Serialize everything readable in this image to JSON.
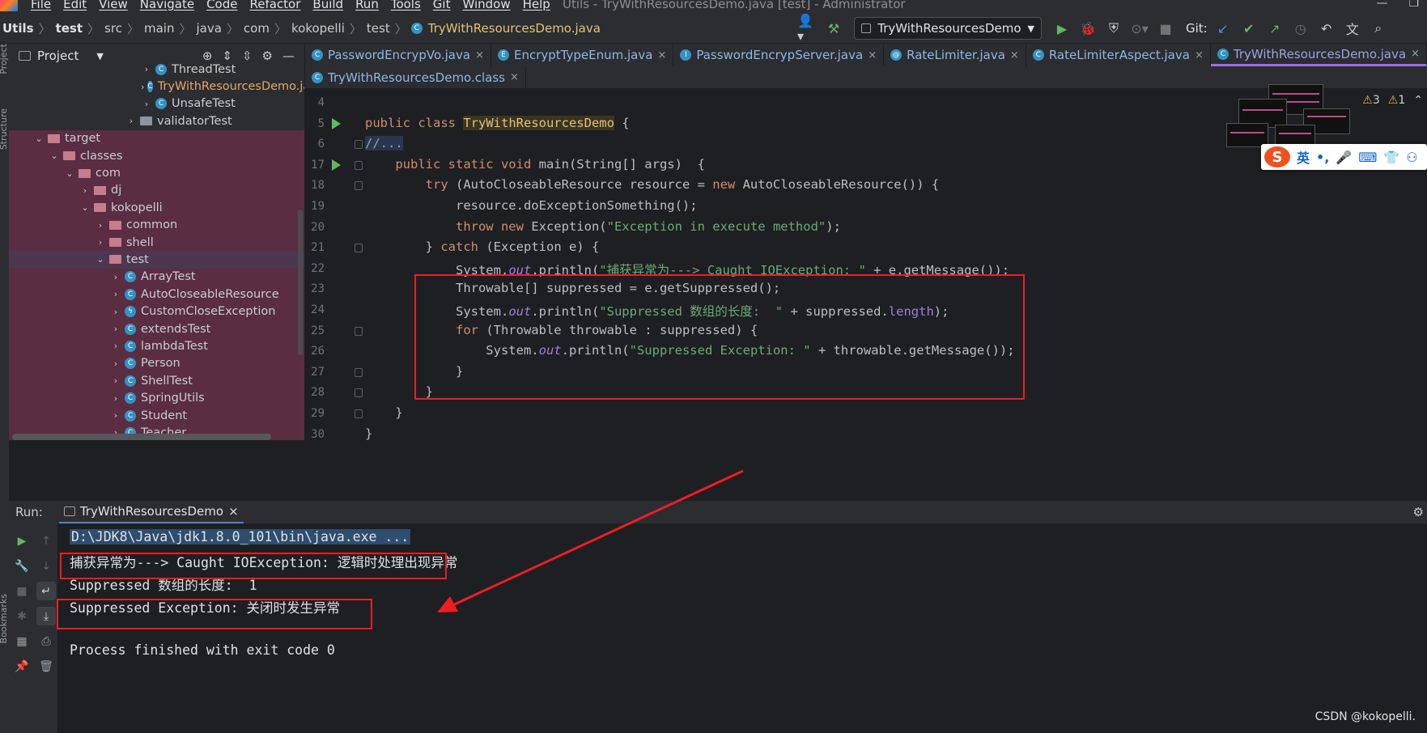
{
  "menu": {
    "items": [
      "File",
      "Edit",
      "View",
      "Navigate",
      "Code",
      "Refactor",
      "Build",
      "Run",
      "Tools",
      "Git",
      "Window",
      "Help"
    ],
    "window_title": "Utils - TryWithResourcesDemo.java [test] - Administrator"
  },
  "breadcrumb": [
    "Utils",
    "test",
    "src",
    "main",
    "java",
    "com",
    "kokopelli",
    "test",
    "TryWithResourcesDemo.java"
  ],
  "toolbar": {
    "run_config": "TryWithResourcesDemo",
    "git_label": "Git:"
  },
  "project": {
    "title": "Project",
    "tree": [
      {
        "label": "ThreadTest",
        "kind": "class",
        "depth": 9,
        "arrow": "›",
        "bg": ""
      },
      {
        "label": "TryWithResourcesDemo.java",
        "kind": "class",
        "depth": 9,
        "arrow": "›",
        "bg": "",
        "orange": true
      },
      {
        "label": "UnsafeTest",
        "kind": "class",
        "depth": 9,
        "arrow": "›",
        "bg": ""
      },
      {
        "label": "validatorTest",
        "kind": "dirgrey",
        "depth": 8,
        "arrow": "›",
        "bg": ""
      },
      {
        "label": "target",
        "kind": "dir",
        "depth": 2,
        "arrow": "⌄",
        "bg": "pink"
      },
      {
        "label": "classes",
        "kind": "dir",
        "depth": 3,
        "arrow": "⌄",
        "bg": "pink"
      },
      {
        "label": "com",
        "kind": "dir",
        "depth": 4,
        "arrow": "⌄",
        "bg": "pink"
      },
      {
        "label": "dj",
        "kind": "dir",
        "depth": 5,
        "arrow": "›",
        "bg": "pink"
      },
      {
        "label": "kokopelli",
        "kind": "dir",
        "depth": 5,
        "arrow": "⌄",
        "bg": "pink"
      },
      {
        "label": "common",
        "kind": "dir",
        "depth": 6,
        "arrow": "›",
        "bg": "pink"
      },
      {
        "label": "shell",
        "kind": "dir",
        "depth": 6,
        "arrow": "›",
        "bg": "pink"
      },
      {
        "label": "test",
        "kind": "dir",
        "depth": 6,
        "arrow": "⌄",
        "bg": "sel"
      },
      {
        "label": "ArrayTest",
        "kind": "class",
        "depth": 7,
        "arrow": "›",
        "bg": "pink"
      },
      {
        "label": "AutoCloseableResource",
        "kind": "class",
        "depth": 7,
        "arrow": "›",
        "bg": "pink"
      },
      {
        "label": "CustomCloseException",
        "kind": "lightning",
        "depth": 7,
        "arrow": "›",
        "bg": "pink"
      },
      {
        "label": "extendsTest",
        "kind": "class",
        "depth": 7,
        "arrow": "›",
        "bg": "pink"
      },
      {
        "label": "lambdaTest",
        "kind": "class",
        "depth": 7,
        "arrow": "›",
        "bg": "pink"
      },
      {
        "label": "Person",
        "kind": "class",
        "depth": 7,
        "arrow": "›",
        "bg": "pink"
      },
      {
        "label": "ShellTest",
        "kind": "class",
        "depth": 7,
        "arrow": "›",
        "bg": "pink"
      },
      {
        "label": "SpringUtils",
        "kind": "class",
        "depth": 7,
        "arrow": "›",
        "bg": "pink"
      },
      {
        "label": "Student",
        "kind": "class",
        "depth": 7,
        "arrow": "›",
        "bg": "pink"
      },
      {
        "label": "Teacher",
        "kind": "class",
        "depth": 7,
        "arrow": "›",
        "bg": "pink"
      }
    ]
  },
  "tabs_row1": [
    {
      "label": "PasswordEncrypVo.java",
      "icon": "C",
      "active": false
    },
    {
      "label": "EncryptTypeEnum.java",
      "icon": "E",
      "active": false
    },
    {
      "label": "PasswordEncrypServer.java",
      "icon": "I",
      "active": false
    },
    {
      "label": "RateLimiter.java",
      "icon": "@",
      "active": false
    },
    {
      "label": "RateLimiterAspect.java",
      "icon": "C",
      "active": false
    },
    {
      "label": "TryWithResourcesDemo.java",
      "icon": "C",
      "active": true
    }
  ],
  "tabs_row2": [
    {
      "label": "TryWithResourcesDemo.class",
      "icon": "C",
      "active": false
    }
  ],
  "inspections": {
    "warnings": "3",
    "weak": "1"
  },
  "code_lines": [
    {
      "num": "4",
      "html": ""
    },
    {
      "num": "5",
      "run": true,
      "html": "<span class=\"kw\">public class </span><span class=\"cls\">TryWithResourcesDemo</span> {"
    },
    {
      "num": "6",
      "fold": true,
      "html": "<span class=\"cm\">//...</span>"
    },
    {
      "num": "17",
      "run": true,
      "fold": true,
      "html": "    <span class=\"kw\">public static void </span>main(String[] args)  {"
    },
    {
      "num": "18",
      "fold": true,
      "html": "        <span class=\"kw\">try </span>(AutoCloseableResource resource = <span class=\"kw\">new </span>AutoCloseableResource()) {"
    },
    {
      "num": "19",
      "html": "            resource.doExceptionSomething();"
    },
    {
      "num": "20",
      "html": "            <span class=\"kw\">throw new </span>Exception(<span class=\"str\">\"Exception in execute method\"</span>);"
    },
    {
      "num": "21",
      "fold": true,
      "html": "        } <span class=\"kw\">catch </span>(Exception e) {"
    },
    {
      "num": "22",
      "html": "            System.<span class=\"fld\">out</span>.println(<span class=\"str\">\"捕获异常为---> Caught IOException: \"</span> + e.getMessage());"
    },
    {
      "num": "23",
      "html": "            Throwable[] suppressed = e.getSuppressed();"
    },
    {
      "num": "24",
      "html": "            System.<span class=\"fld\">out</span>.println(<span class=\"str\">\"Suppressed 数组的长度:  \"</span> + suppressed.<span class=\"prop\">length</span>);"
    },
    {
      "num": "25",
      "fold": true,
      "html": "            <span class=\"kw\">for </span>(Throwable throwable : suppressed) {"
    },
    {
      "num": "26",
      "html": "                System.<span class=\"fld\">out</span>.println(<span class=\"str\">\"Suppressed Exception: \"</span> + throwable.getMessage());"
    },
    {
      "num": "27",
      "fold": true,
      "html": "            }"
    },
    {
      "num": "28",
      "fold": true,
      "html": "        }"
    },
    {
      "num": "29",
      "fold": true,
      "html": "    }"
    },
    {
      "num": "30",
      "html": "}"
    }
  ],
  "run_panel": {
    "label": "Run:",
    "tab": "TryWithResourcesDemo",
    "console": [
      "D:\\JDK8\\Java\\jdk1.8.0_101\\bin\\java.exe ...",
      "捕获异常为---> Caught IOException: 逻辑时处理出现异常",
      "Suppressed 数组的长度:  1",
      "Suppressed Exception: 关闭时发生异常",
      "",
      "Process finished with exit code 0"
    ]
  },
  "left_strip": {
    "project": "Project",
    "structure": "Structure",
    "bookmarks": "Bookmarks"
  },
  "ime": {
    "lang": "英"
  },
  "watermark": "CSDN @kokopelli.",
  "colors": {
    "accent_red": "#ee1d23",
    "tab_active": "#a06be0",
    "run_green": "#5fb95f"
  }
}
